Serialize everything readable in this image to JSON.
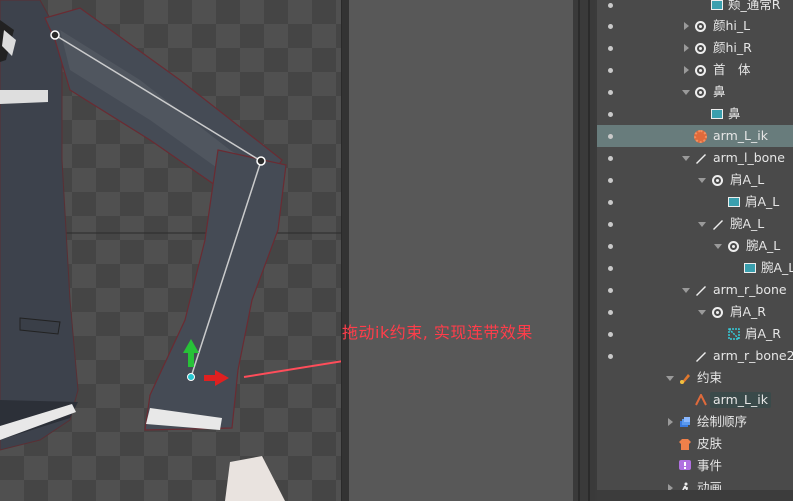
{
  "annotation": {
    "text": "拖动ik约束, 实现连带效果"
  },
  "tree": {
    "rows": [
      {
        "label": "颊_通常R",
        "icon": "slot-icon"
      },
      {
        "label": "颜hi_L",
        "icon": "bone-icon"
      },
      {
        "label": "颜hi_R",
        "icon": "bone-icon"
      },
      {
        "label": "首　体",
        "icon": "bone-icon"
      },
      {
        "label": "鼻",
        "icon": "bone-icon"
      },
      {
        "label": "鼻",
        "icon": "slot-icon"
      },
      {
        "label": "arm_L_ik",
        "icon": "ik-target-icon"
      },
      {
        "label": "arm_l_bone",
        "icon": "pen-bone-icon"
      },
      {
        "label": "肩A_L",
        "icon": "bone-icon"
      },
      {
        "label": "肩A_L",
        "icon": "slot-icon"
      },
      {
        "label": "腕A_L",
        "icon": "pen-bone-icon"
      },
      {
        "label": "腕A_L",
        "icon": "bone-icon"
      },
      {
        "label": "腕A_L",
        "icon": "slot-icon"
      },
      {
        "label": "arm_r_bone",
        "icon": "pen-bone-icon"
      },
      {
        "label": "肩A_R",
        "icon": "bone-icon"
      },
      {
        "label": "肩A_R",
        "icon": "mesh-icon"
      },
      {
        "label": "arm_r_bone2",
        "icon": "pen-bone-icon"
      },
      {
        "label": "约束",
        "icon": "constraint-icon"
      },
      {
        "label": "arm_L_ik",
        "icon": "ik-constraint-icon"
      },
      {
        "label": "绘制顺序",
        "icon": "draw-order-icon"
      },
      {
        "label": "皮肤",
        "icon": "skin-icon"
      },
      {
        "label": "事件",
        "icon": "event-icon"
      },
      {
        "label": "动画",
        "icon": "animation-icon"
      }
    ]
  }
}
